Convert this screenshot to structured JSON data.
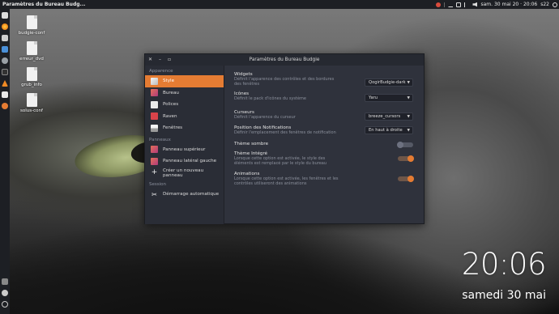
{
  "topbar": {
    "window_title": "Paramètres du Bureau Budg...",
    "clock": "sam. 30 mai 20 · 20:06",
    "session": "s22"
  },
  "desktop_icons": [
    {
      "label": "budgie-conf"
    },
    {
      "label": "erreur_dvd"
    },
    {
      "label": "grub_info"
    },
    {
      "label": "solus-conf"
    }
  ],
  "window": {
    "title": "Paramètres du Bureau Budgie",
    "sidebar": {
      "sections": [
        {
          "title": "Apparence",
          "items": [
            {
              "label": "Style",
              "active": true
            },
            {
              "label": "Bureau"
            },
            {
              "label": "Polices"
            },
            {
              "label": "Raven"
            },
            {
              "label": "Fenêtres"
            }
          ]
        },
        {
          "title": "Panneaux",
          "items": [
            {
              "label": "Panneau supérieur"
            },
            {
              "label": "Panneau latéral gauche"
            },
            {
              "label": "Créer un nouveau panneau"
            }
          ]
        },
        {
          "title": "Session",
          "items": [
            {
              "label": "Démarrage automatique"
            }
          ]
        }
      ]
    },
    "settings": [
      {
        "label": "Widgets",
        "desc": "Définit l'apparence des contrôles et des bordures des fenêtres",
        "control": "select",
        "value": "QogirBudgie-dark"
      },
      {
        "label": "Icônes",
        "desc": "Définit le pack d'icônes du système",
        "control": "select",
        "value": "Yaru"
      },
      {
        "label": "Curseurs",
        "desc": "Définit l'apparence du curseur",
        "control": "select",
        "value": "breeze_cursors"
      },
      {
        "label": "Position des Notifications",
        "desc": "Définir l'emplacement des fenêtres de notification",
        "control": "select",
        "value": "En haut à droite"
      },
      {
        "label": "Thème sombre",
        "desc": "",
        "control": "toggle",
        "value": false
      },
      {
        "label": "Thème Intégré",
        "desc": "Lorsque cette option est activée, le style des éléments est remplacé par le style du bureau",
        "control": "toggle",
        "value": true
      },
      {
        "label": "Animations",
        "desc": "Lorsque cette option est activée, les fenêtres et les contrôles utiliseront des animations",
        "control": "toggle",
        "value": true
      }
    ]
  },
  "desktop_clock": {
    "time": "20:06",
    "date": "samedi 30 mai"
  },
  "colors": {
    "accent": "#e57c33"
  }
}
